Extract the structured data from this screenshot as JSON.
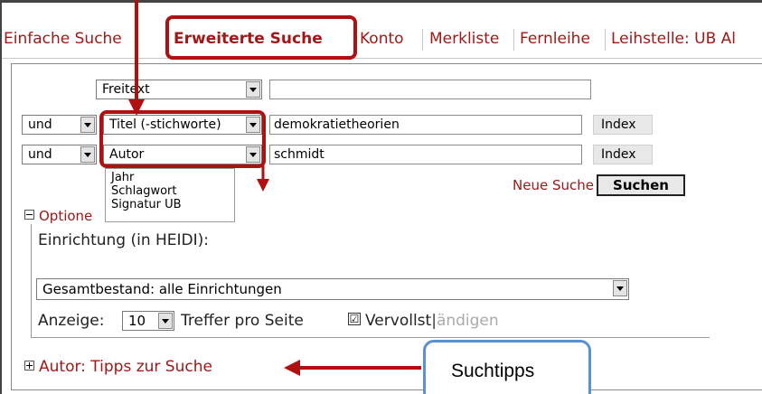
{
  "tabs": [
    {
      "label": "Einfache Suche",
      "active": false
    },
    {
      "label": "Erweiterte Suche",
      "active": true
    },
    {
      "label": "Konto",
      "active": false
    },
    {
      "label": "Merkliste",
      "active": false
    },
    {
      "label": "Fernleihe",
      "active": false
    },
    {
      "label": "Leihstelle: UB Al",
      "active": false
    }
  ],
  "search_rows": [
    {
      "operator": "",
      "field": "Freitext",
      "value": "",
      "has_index": false
    },
    {
      "operator": "und",
      "field": "Titel (-stichworte)",
      "value": "demokratietheorien",
      "has_index": true
    },
    {
      "operator": "und",
      "field": "Autor",
      "value": "schmidt",
      "has_index": true
    }
  ],
  "index_label": "Index",
  "field_dropdown_options": [
    "Jahr",
    "Schlagwort",
    "Signatur UB"
  ],
  "neue_suche_label": "Neue Suche",
  "suchen_label": "Suchen",
  "optionen_label": "Optione",
  "einrichtung_label": "Einrichtung (in HEIDI):",
  "bestand_value": "Gesamtbestand: alle Einrichtungen",
  "anzeige_label": "Anzeige:",
  "anzeige_value": "10",
  "treffer_label": "Treffer pro Seite",
  "vervollst_label": "Vervollst",
  "vervollst_dim": "ändigen",
  "vervollst_checked": "☑",
  "tipps_label": "Autor: Tipps zur Suche",
  "callout_label": "Suchtipps",
  "colors": {
    "accent": "#a01818",
    "highlight": "#b01010",
    "callout_border": "#5b8fd6"
  }
}
